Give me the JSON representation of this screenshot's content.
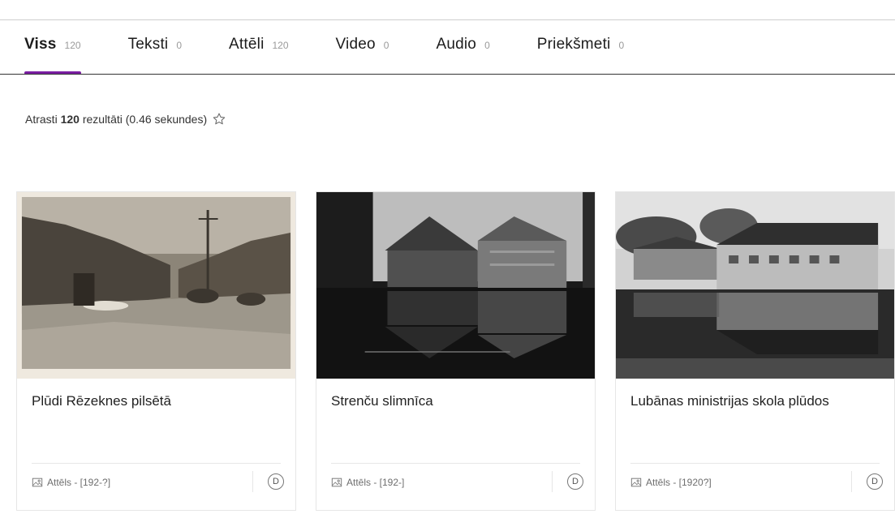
{
  "tabs": [
    {
      "label": "Viss",
      "count": "120",
      "active": true
    },
    {
      "label": "Teksti",
      "count": "0",
      "active": false
    },
    {
      "label": "Attēli",
      "count": "120",
      "active": false
    },
    {
      "label": "Video",
      "count": "0",
      "active": false
    },
    {
      "label": "Audio",
      "count": "0",
      "active": false
    },
    {
      "label": "Priekšmeti",
      "count": "0",
      "active": false
    }
  ],
  "results": {
    "prefix": "Atrasti",
    "count": "120",
    "suffix": "rezultāti (0.46 sekundes)"
  },
  "cards": [
    {
      "title": "Plūdi Rēzeknes pilsētā",
      "meta": "Attēls - [192-?]",
      "badge": "D",
      "icon": "image-icon"
    },
    {
      "title": "Strenču slimnīca",
      "meta": "Attēls - [192-]",
      "badge": "D",
      "icon": "image-icon"
    },
    {
      "title": "Lubānas ministrijas skola plūdos",
      "meta": "Attēls - [1920?]",
      "badge": "D",
      "icon": "image-icon"
    }
  ],
  "colors": {
    "accent": "#7a1ea1",
    "tab_count": "#9a9a9a",
    "text": "#222222"
  }
}
